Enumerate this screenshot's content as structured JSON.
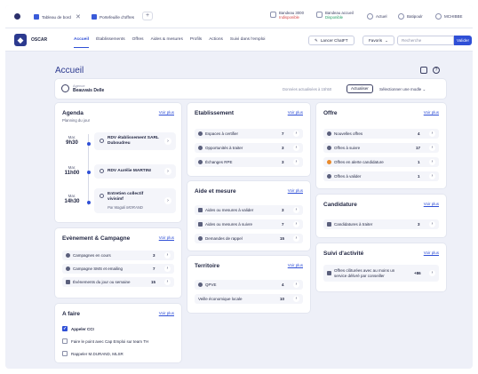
{
  "browser": {
    "tabs": [
      {
        "label": "Tableau de bord"
      },
      {
        "label": "Portefeuille d'offres"
      }
    ],
    "new_tab": "+",
    "status": [
      {
        "title": "Bandeau 3000",
        "state": "Indisponible"
      },
      {
        "title": "Bandeau accueil",
        "state": "Disponible"
      }
    ],
    "actions": [
      "Actuel",
      "Batipoulr",
      "MCHIBBE"
    ]
  },
  "nav": {
    "logo": "◆",
    "brand": "OSCAR",
    "menu": [
      "Accueil",
      "Établissements",
      "Offres",
      "Aides & mesures",
      "Profils",
      "Actions",
      "Suivi dans l'emploi"
    ],
    "chat_button": "Lancer ChatFT",
    "favorites": "Favoris",
    "search_placeholder": "Recherche",
    "validate": "Valider"
  },
  "page": {
    "title": "Accueil",
    "agency_label": "Agence",
    "agency_name": "Beauvais Delle",
    "updated": "Données actualisées à 15h50",
    "refresh": "Actualiser",
    "mode": "Sélectionner une modle ⌄"
  },
  "agenda": {
    "title": "Agenda",
    "see_all": "Voir plus",
    "subtitle": "Planning du jour",
    "items": [
      {
        "day": "Mar.",
        "time": "9h30",
        "title": "RDV établissement SARL Duboudreu",
        "sub": ""
      },
      {
        "day": "Mar.",
        "time": "11h00",
        "title": "RDV Aurélie MARTINI",
        "sub": ""
      },
      {
        "day": "Mar.",
        "time": "14h30",
        "title": "Entretien collectif vivisimf",
        "sub": "Par Magali MORAND"
      }
    ]
  },
  "events": {
    "title": "Evènement & Campagne",
    "see_all": "Voir plus",
    "rows": [
      {
        "label": "Campagnes en cours",
        "count": "3"
      },
      {
        "label": "Campagne SMS et emailing",
        "count": "7"
      },
      {
        "label": "Évènements du jour ou semaine",
        "count": "15"
      }
    ]
  },
  "todo": {
    "title": "A faire",
    "see_all": "Voir plus",
    "items": [
      {
        "label": "Appeler CCI",
        "done": true
      },
      {
        "label": "Faire le point avec Cap Emploi sur team TH",
        "done": false
      },
      {
        "label": "Rappeler M.DURAND, MLSR",
        "done": false
      }
    ]
  },
  "etablissement": {
    "title": "Etablissement",
    "see_all": "Voir plus",
    "rows": [
      {
        "label": "Espaces à certifier",
        "count": "7"
      },
      {
        "label": "Opportunités à traiter",
        "count": "3"
      },
      {
        "label": "Échanges RPE",
        "count": "3"
      }
    ]
  },
  "aide": {
    "title": "Aide et mesure",
    "see_all": "Voir plus",
    "rows": [
      {
        "label": "Aides ou mesures à valider",
        "count": "3"
      },
      {
        "label": "Aides ou mesures à suivre",
        "count": "7"
      },
      {
        "label": "Demandes de rappel",
        "count": "15"
      }
    ]
  },
  "territoire": {
    "title": "Territoire",
    "see_all": "Voir plus",
    "rows": [
      {
        "label": "QPVE",
        "count": "4"
      },
      {
        "label": "Veille économique locale",
        "count": "10"
      }
    ]
  },
  "offre": {
    "title": "Offre",
    "see_all": "Voir plus",
    "rows": [
      {
        "label": "Nouvelles offres",
        "count": "4",
        "alert": false
      },
      {
        "label": "Offres à suivre",
        "count": "17",
        "alert": false
      },
      {
        "label": "Offres en alerte candidature",
        "count": "1",
        "alert": true
      },
      {
        "label": "Offres à valider",
        "count": "1",
        "alert": false
      }
    ]
  },
  "candidature": {
    "title": "Candidature",
    "see_all": "Voir plus",
    "rows": [
      {
        "label": "Candidatures à traiter",
        "count": "3"
      }
    ]
  },
  "suivi": {
    "title": "Suivi d'activité",
    "see_all": "Voir plus",
    "row": {
      "label": "Offres clôturées avec au moins un service délivré par conseiller",
      "count": "+86"
    }
  },
  "colors": {
    "accent": "#2f4fd6",
    "brand": "#2c3a8f",
    "alert": "#e98a2b"
  }
}
